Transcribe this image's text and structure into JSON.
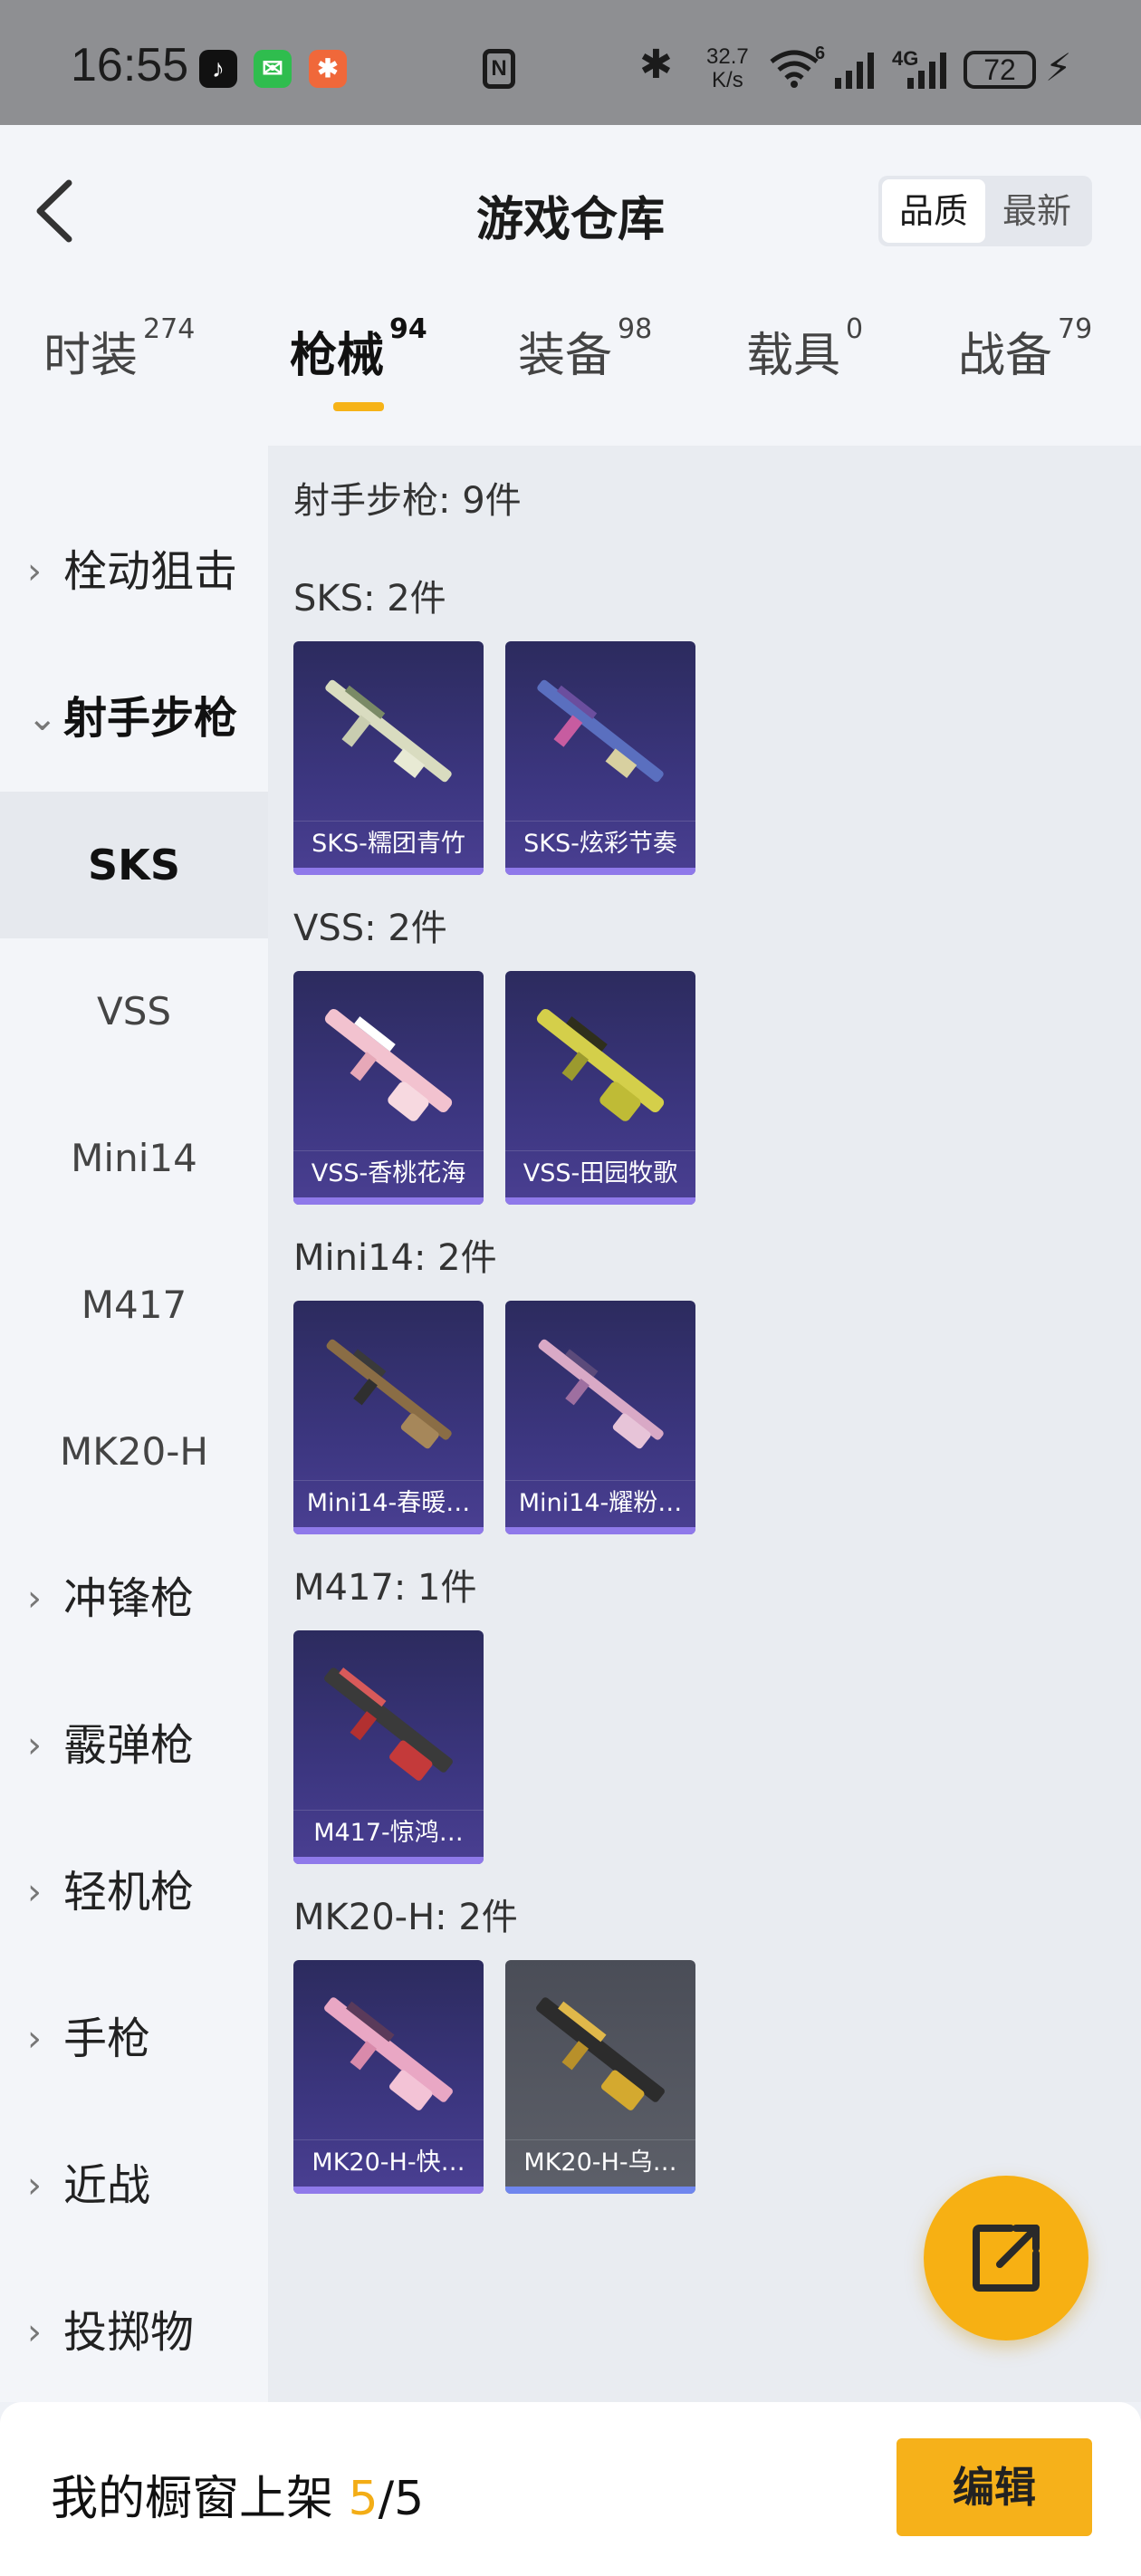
{
  "status_bar": {
    "time": "16:55",
    "net_speed_value": "32.7",
    "net_speed_unit": "K/s",
    "wifi_badge": "6",
    "network_type": "4G",
    "battery": "72"
  },
  "header": {
    "title": "游戏仓库",
    "sort_options": [
      "品质",
      "最新"
    ]
  },
  "tabs": [
    {
      "label": "时装",
      "count": "274"
    },
    {
      "label": "枪械",
      "count": "94"
    },
    {
      "label": "装备",
      "count": "98"
    },
    {
      "label": "载具",
      "count": "0"
    },
    {
      "label": "战备",
      "count": "79"
    }
  ],
  "sidebar": {
    "items": [
      {
        "label": "栓动狙击"
      },
      {
        "label": "射手步枪"
      },
      {
        "label": "冲锋枪"
      },
      {
        "label": "霰弹枪"
      },
      {
        "label": "轻机枪"
      },
      {
        "label": "手枪"
      },
      {
        "label": "近战"
      },
      {
        "label": "投掷物"
      }
    ],
    "subitems": [
      "SKS",
      "VSS",
      "Mini14",
      "M417",
      "MK20-H"
    ]
  },
  "content": {
    "section_title": "射手步枪: 9件",
    "groups": [
      {
        "title": "SKS: 2件",
        "items": [
          "SKS-糯团青竹",
          "SKS-炫彩节奏"
        ]
      },
      {
        "title": "VSS: 2件",
        "items": [
          "VSS-香桃花海",
          "VSS-田园牧歌"
        ]
      },
      {
        "title": "Mini14: 2件",
        "items": [
          "Mini14-春暖…",
          "Mini14-耀粉…"
        ]
      },
      {
        "title": "M417: 1件",
        "items": [
          "M417-惊鸿…"
        ]
      },
      {
        "title": "MK20-H: 2件",
        "items": [
          "MK20-H-快…",
          "MK20-H-乌…"
        ]
      }
    ]
  },
  "bottom_bar": {
    "label": "我的橱窗上架",
    "current": "5",
    "separator_total": "/5",
    "edit_label": "编辑"
  },
  "colors": {
    "accent": "#f6b11a",
    "card_purple": "#3c3680",
    "card_grey": "#5d6069"
  },
  "icons": [
    "back-arrow-icon",
    "share-external-icon",
    "chevron-right-icon",
    "chevron-down-icon"
  ]
}
